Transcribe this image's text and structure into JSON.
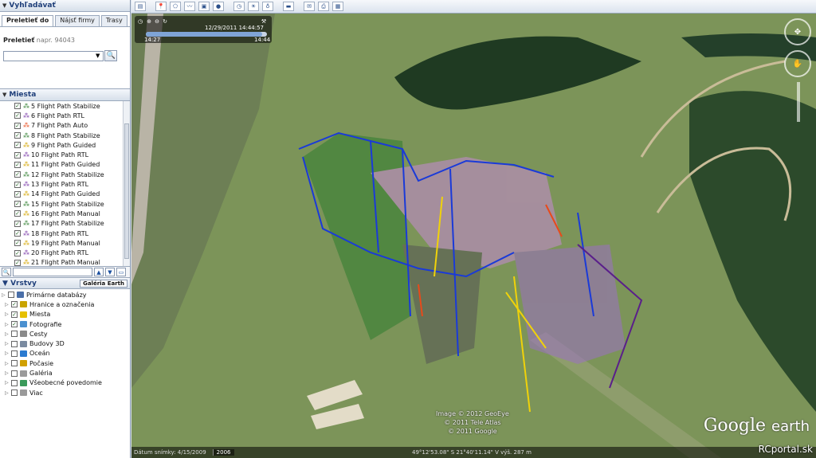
{
  "search": {
    "title": "Vyhľadávať",
    "tabs": [
      "Preletieť do",
      "Nájsť firmy",
      "Trasy"
    ],
    "fly_label": "Preletieť",
    "fly_hint": "napr. 94043",
    "placeholder": ""
  },
  "places": {
    "title": "Miesta",
    "items": [
      "5 Flight Path Stabilize",
      "6 Flight Path RTL",
      "7 Flight Path Auto",
      "8 Flight Path Stabilize",
      "9 Flight Path Guided",
      "10 Flight Path RTL",
      "11 Flight Path Guided",
      "12 Flight Path Stabilize",
      "13 Flight Path RTL",
      "14 Flight Path Guided",
      "15 Flight Path Stabilize",
      "16 Flight Path Manual",
      "17 Flight Path Stabilize",
      "18 Flight Path RTL",
      "19 Flight Path Manual",
      "20 Flight Path RTL",
      "21 Flight Path Manual"
    ]
  },
  "layers": {
    "title": "Vrstvy",
    "gallery_button": "Galéria Earth",
    "items": [
      {
        "label": "Primárne databázy",
        "checked": false,
        "indent": 0
      },
      {
        "label": "Hranice a označenia",
        "checked": true,
        "indent": 1
      },
      {
        "label": "Miesta",
        "checked": true,
        "indent": 1
      },
      {
        "label": "Fotografie",
        "checked": true,
        "indent": 1
      },
      {
        "label": "Cesty",
        "checked": false,
        "indent": 1
      },
      {
        "label": "Budovy 3D",
        "checked": false,
        "indent": 1
      },
      {
        "label": "Oceán",
        "checked": false,
        "indent": 1
      },
      {
        "label": "Počasie",
        "checked": false,
        "indent": 1
      },
      {
        "label": "Galéria",
        "checked": false,
        "indent": 1
      },
      {
        "label": "Všeobecné povedomie",
        "checked": false,
        "indent": 1
      },
      {
        "label": "Viac",
        "checked": false,
        "indent": 1
      }
    ]
  },
  "time_slider": {
    "current": "12/29/2011  14:44:57",
    "start": "14:27",
    "end": "14:44",
    "progress": 0.96
  },
  "map": {
    "credits": [
      "Image © 2012 GeoEye",
      "© 2011 Tele Atlas",
      "© 2011 Google"
    ],
    "logo_main": "Google",
    "logo_sub": "earth",
    "watermark": "RCportal.sk"
  },
  "status": {
    "imagery_date": "Dátum snímky: 4/15/2009",
    "year": "2006",
    "coords": "49°12'53.08\" S   21°40'11.14\" V  výš.  287 m"
  }
}
